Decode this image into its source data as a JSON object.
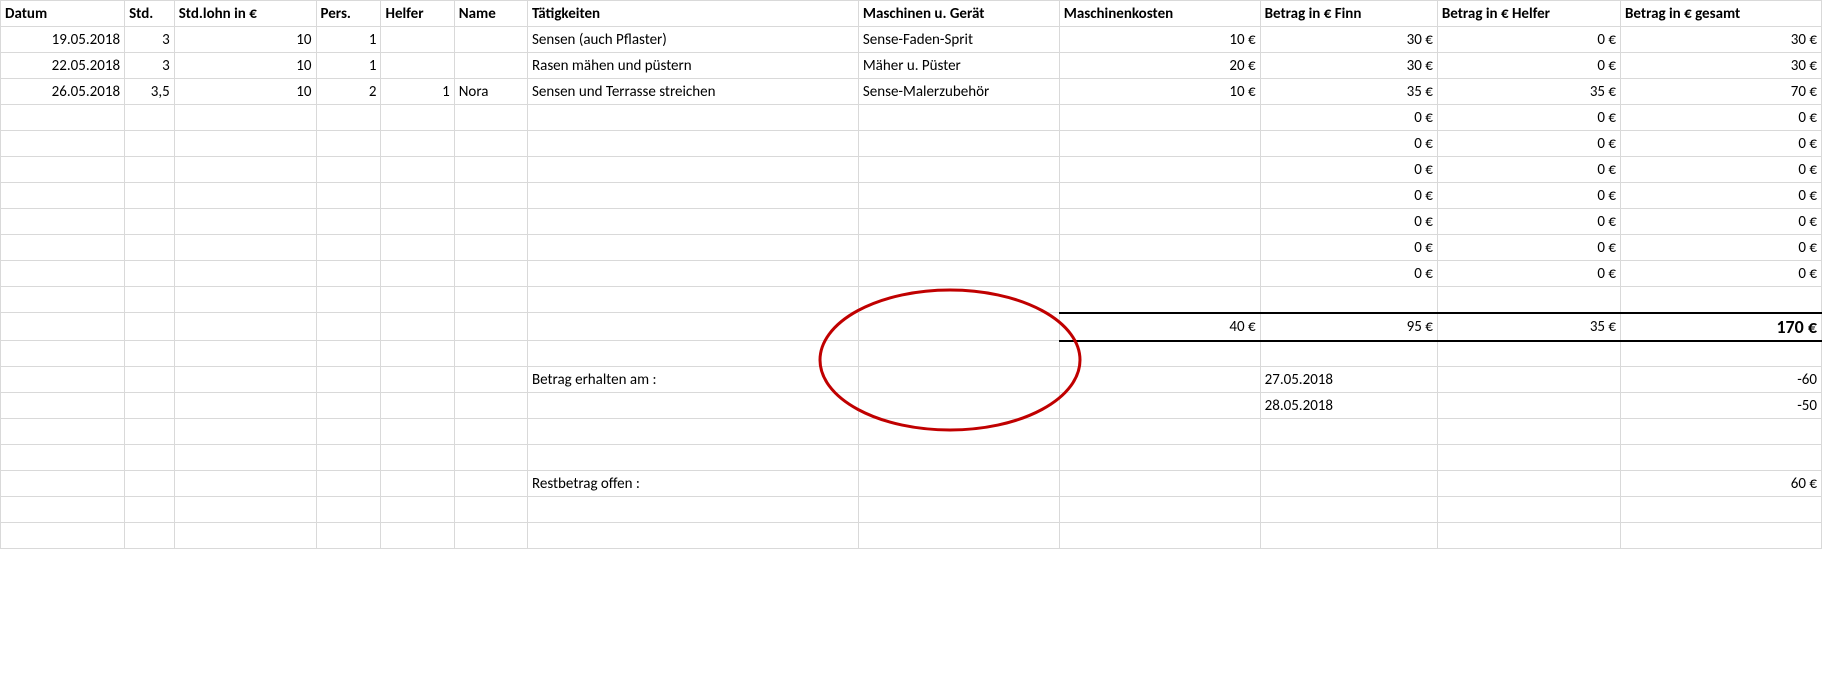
{
  "headers": {
    "datum": "Datum",
    "std": "Std.",
    "stdlohn": "Std.lohn in €",
    "pers": "Pers.",
    "helfer": "Helfer",
    "name": "Name",
    "taet": "Tätigkeiten",
    "masch": "Maschinen u. Gerät",
    "maschk": "Maschinenkosten",
    "finn": "Betrag in € Finn",
    "helferb": "Betrag in € Helfer",
    "gesamt": "Betrag in € gesamt"
  },
  "rows": [
    {
      "datum": "19.05.2018",
      "std": "3",
      "stdlohn": "10",
      "pers": "1",
      "helfer": "",
      "name": "",
      "taet": "Sensen (auch Pflaster)",
      "masch": "Sense-Faden-Sprit",
      "maschk": "10 €",
      "finn": "30 €",
      "helferb": "0 €",
      "gesamt": "30 €"
    },
    {
      "datum": "22.05.2018",
      "std": "3",
      "stdlohn": "10",
      "pers": "1",
      "helfer": "",
      "name": "",
      "taet": "Rasen mähen und püstern",
      "masch": "Mäher u. Püster",
      "maschk": "20 €",
      "finn": "30 €",
      "helferb": "0 €",
      "gesamt": "30 €"
    },
    {
      "datum": "26.05.2018",
      "std": "3,5",
      "stdlohn": "10",
      "pers": "2",
      "helfer": "1",
      "name": "Nora",
      "taet": "Sensen und Terrasse streichen",
      "masch": "Sense-Malerzubehör",
      "maschk": "10 €",
      "finn": "35 €",
      "helferb": "35 €",
      "gesamt": "70 €"
    },
    {
      "datum": "",
      "std": "",
      "stdlohn": "",
      "pers": "",
      "helfer": "",
      "name": "",
      "taet": "",
      "masch": "",
      "maschk": "",
      "finn": "0 €",
      "helferb": "0 €",
      "gesamt": "0 €"
    },
    {
      "datum": "",
      "std": "",
      "stdlohn": "",
      "pers": "",
      "helfer": "",
      "name": "",
      "taet": "",
      "masch": "",
      "maschk": "",
      "finn": "0 €",
      "helferb": "0 €",
      "gesamt": "0 €"
    },
    {
      "datum": "",
      "std": "",
      "stdlohn": "",
      "pers": "",
      "helfer": "",
      "name": "",
      "taet": "",
      "masch": "",
      "maschk": "",
      "finn": "0 €",
      "helferb": "0 €",
      "gesamt": "0 €"
    },
    {
      "datum": "",
      "std": "",
      "stdlohn": "",
      "pers": "",
      "helfer": "",
      "name": "",
      "taet": "",
      "masch": "",
      "maschk": "",
      "finn": "0 €",
      "helferb": "0 €",
      "gesamt": "0 €"
    },
    {
      "datum": "",
      "std": "",
      "stdlohn": "",
      "pers": "",
      "helfer": "",
      "name": "",
      "taet": "",
      "masch": "",
      "maschk": "",
      "finn": "0 €",
      "helferb": "0 €",
      "gesamt": "0 €"
    },
    {
      "datum": "",
      "std": "",
      "stdlohn": "",
      "pers": "",
      "helfer": "",
      "name": "",
      "taet": "",
      "masch": "",
      "maschk": "",
      "finn": "0 €",
      "helferb": "0 €",
      "gesamt": "0 €"
    },
    {
      "datum": "",
      "std": "",
      "stdlohn": "",
      "pers": "",
      "helfer": "",
      "name": "",
      "taet": "",
      "masch": "",
      "maschk": "",
      "finn": "0 €",
      "helferb": "0 €",
      "gesamt": "0 €"
    }
  ],
  "sums": {
    "maschk": "40 €",
    "finn": "95 €",
    "helferb": "35 €",
    "gesamt": "170 €"
  },
  "received_label": "Betrag erhalten am :",
  "received": [
    {
      "date": "27.05.2018",
      "amount": "-60"
    },
    {
      "date": "28.05.2018",
      "amount": "-50"
    }
  ],
  "rest_label": "Restbetrag offen :",
  "rest_amount": "60 €"
}
